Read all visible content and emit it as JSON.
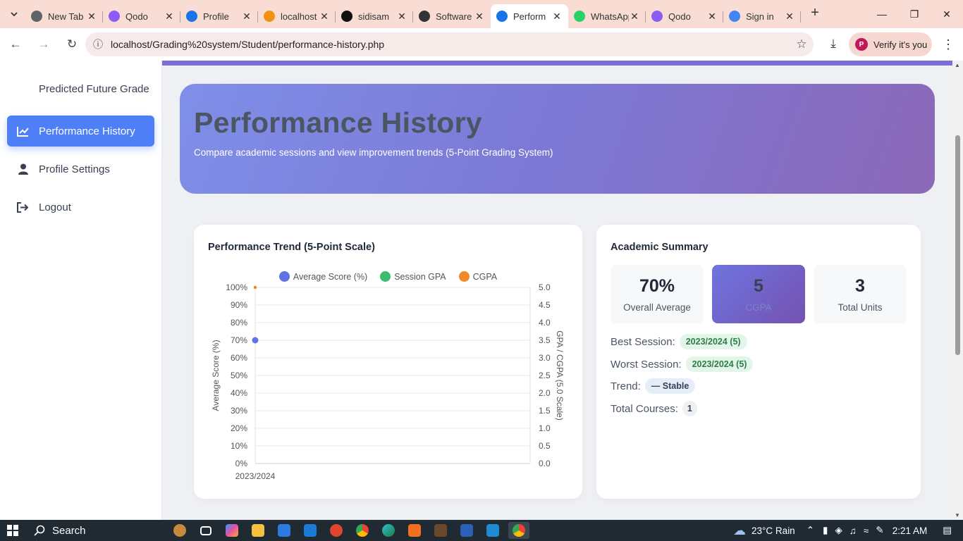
{
  "browser": {
    "tabs": [
      {
        "title": "New Tab",
        "icon": "chrome-icon",
        "color": "#5f6368",
        "active": false
      },
      {
        "title": "Qodo",
        "icon": "qodo-icon",
        "color": "#8b5cf6",
        "active": false
      },
      {
        "title": "Profile",
        "icon": "app-a-icon",
        "color": "#1a73e8",
        "active": false
      },
      {
        "title": "localhost",
        "icon": "phpmyadmin-icon",
        "color": "#f29111",
        "active": false
      },
      {
        "title": "sidisam",
        "icon": "github-icon",
        "color": "#111111",
        "active": false
      },
      {
        "title": "Software",
        "icon": "openai-icon",
        "color": "#333333",
        "active": false
      },
      {
        "title": "Perform",
        "icon": "app-a-icon",
        "color": "#1a73e8",
        "active": true
      },
      {
        "title": "WhatsApp",
        "icon": "whatsapp-icon",
        "color": "#25d366",
        "active": false
      },
      {
        "title": "Qodo",
        "icon": "qodo-icon",
        "color": "#8b5cf6",
        "active": false
      },
      {
        "title": "Sign in",
        "icon": "google-icon",
        "color": "#4285f4",
        "active": false
      }
    ],
    "url": "localhost/Grading%20system/Student/performance-history.php",
    "verify_label": "Verify it's you",
    "profile_initial": "P"
  },
  "sidebar": {
    "items": [
      {
        "label": "Predicted Future Grade",
        "icon": "",
        "active": false
      },
      {
        "label": "Performance History",
        "icon": "chart-line-icon",
        "active": true
      },
      {
        "label": "Profile Settings",
        "icon": "user-icon",
        "active": false
      },
      {
        "label": "Logout",
        "icon": "logout-icon",
        "active": false
      }
    ]
  },
  "hero": {
    "title": "Performance History",
    "subtitle": "Compare academic sessions and view improvement trends (5-Point Grading System)"
  },
  "trend_card": {
    "title": "Performance Trend (5-Point Scale)"
  },
  "chart_data": {
    "type": "line",
    "categories": [
      "2023/2024"
    ],
    "series": [
      {
        "name": "Average Score (%)",
        "axis": "left",
        "color": "#6272e3",
        "values": [
          70
        ]
      },
      {
        "name": "Session GPA",
        "axis": "right",
        "color": "#3dbb6e",
        "values": [
          5
        ]
      },
      {
        "name": "CGPA",
        "axis": "right",
        "color": "#f08a2c",
        "values": [
          5
        ]
      }
    ],
    "ylabel": "Average Score (%)",
    "ylim": [
      0,
      100
    ],
    "yticks": [
      "0%",
      "10%",
      "20%",
      "30%",
      "40%",
      "50%",
      "60%",
      "70%",
      "80%",
      "90%",
      "100%"
    ],
    "y2label": "GPA / CGPA (5.0 Scale)",
    "y2lim": [
      0,
      5
    ],
    "y2ticks": [
      "0.0",
      "0.5",
      "1.0",
      "1.5",
      "2.0",
      "2.5",
      "3.0",
      "3.5",
      "4.0",
      "4.5",
      "5.0"
    ],
    "legend": "top",
    "grid": true
  },
  "summary": {
    "title": "Academic Summary",
    "stats": [
      {
        "value": "70%",
        "label": "Overall Average"
      },
      {
        "value": "5",
        "label": "CGPA"
      },
      {
        "value": "3",
        "label": "Total Units"
      }
    ],
    "best_label": "Best Session:",
    "best_value": "2023/2024 (5)",
    "worst_label": "Worst Session:",
    "worst_value": "2023/2024 (5)",
    "trend_label": "Trend:",
    "trend_value": "— Stable",
    "courses_label": "Total Courses:",
    "courses_value": "1"
  },
  "taskbar": {
    "search": "Search",
    "weather": "23°C  Rain",
    "time": "2:21 AM"
  }
}
